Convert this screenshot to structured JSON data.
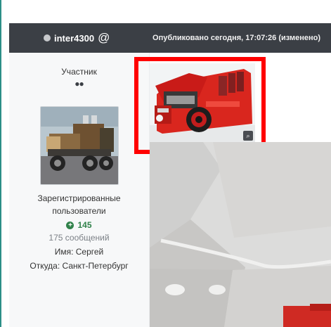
{
  "post": {
    "username": "inter4300",
    "mention_symbol": "@",
    "published": "Опубликовано сегодня, 17:07:26 (изменено)"
  },
  "author": {
    "rank": "Участник",
    "rank_pips": "●●",
    "group_line1": "Зарегистрированные",
    "group_line2": "пользователи",
    "reputation_icon": "plus-circle-icon",
    "reputation": "145",
    "post_count": "175 сообщений",
    "name_line": "Имя: Сергей",
    "location_line": "Откуда: Санкт-Петербург"
  },
  "attachment": {
    "zoom_icon": "magnify-icon",
    "highlight_color": "#ff0000"
  },
  "colors": {
    "header_bg": "#3b3f45",
    "panel_bg": "#f7f8f9",
    "reputation": "#31824b"
  }
}
